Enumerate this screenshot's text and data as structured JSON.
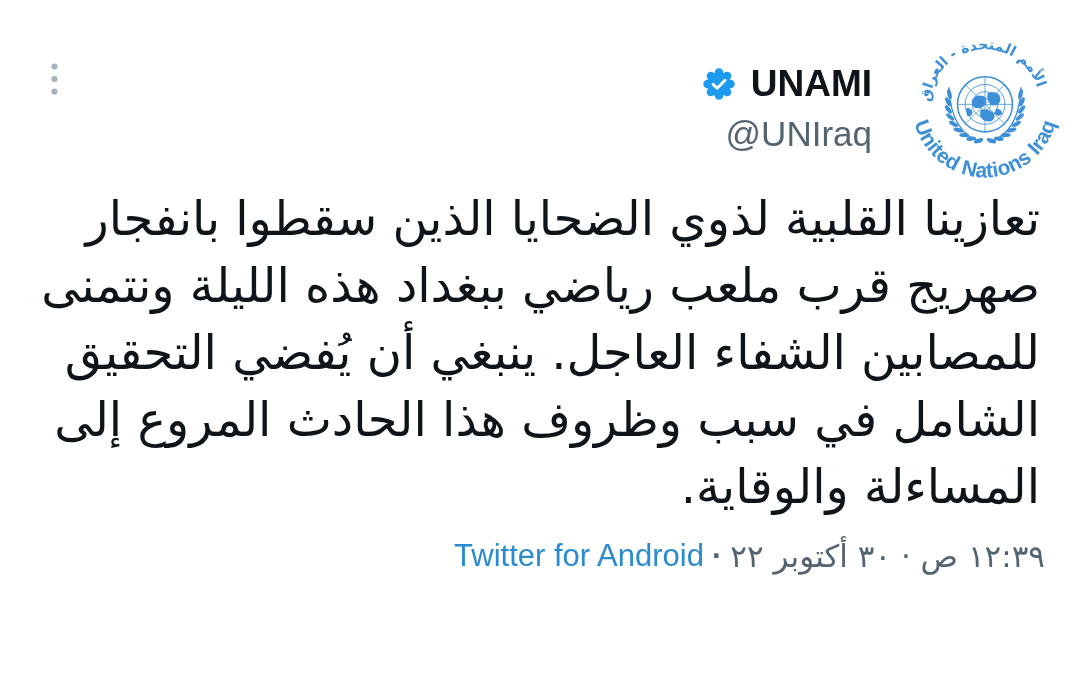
{
  "author": {
    "name": "UNAMI",
    "verified": true,
    "handle": "@UNIraq"
  },
  "logo": {
    "arabic_text": "الأمم المتحدة - العراق",
    "english_text": "United Nations Iraq"
  },
  "tweet": {
    "text": "تعازينا القلبية لذوي الضحايا الذين سقطوا بانفجار صهريج قرب ملعب رياضي ببغداد هذه الليلة ونتمنى للمصابين الشفاء العاجل. ينبغي أن يُفضي التحقيق الشامل في سبب وظروف هذا الحادث المروع إلى المساءلة والوقاية."
  },
  "meta": {
    "timestamp": "١٢:٣٩ ص · ٣٠ أكتوبر ٢٢",
    "separator": "·",
    "source": "Twitter for Android"
  }
}
